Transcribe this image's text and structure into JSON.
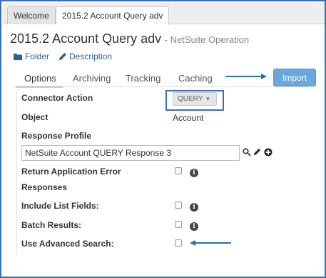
{
  "tabs": [
    {
      "label": "Welcome",
      "active": false
    },
    {
      "label": "2015.2 Account Query adv",
      "active": true
    }
  ],
  "page": {
    "title": "2015.2 Account Query adv",
    "subtitle": "- NetSuite Operation"
  },
  "links": {
    "folder": "Folder",
    "description": "Description"
  },
  "subtabs": [
    {
      "label": "Options",
      "active": true
    },
    {
      "label": "Archiving",
      "active": false
    },
    {
      "label": "Tracking",
      "active": false
    },
    {
      "label": "Caching",
      "active": false
    }
  ],
  "import_button": "Import",
  "form": {
    "connector_action": {
      "label": "Connector Action",
      "value": "QUERY"
    },
    "object": {
      "label": "Object",
      "value": "Account"
    },
    "response_profile": {
      "label": "Response Profile",
      "value": "NetSuite Account QUERY Response 3"
    },
    "return_app_error": {
      "label_line1": "Return Application Error",
      "label_line2": "Responses",
      "checked": false
    },
    "include_list_fields": {
      "label": "Include List Fields:",
      "checked": false
    },
    "batch_results": {
      "label": "Batch Results:",
      "checked": false
    },
    "use_advanced_search": {
      "label": "Use Advanced Search:",
      "checked": false
    }
  },
  "icons": {
    "info": "i",
    "folder": "folder-icon",
    "description": "pencil-icon",
    "search": "search-icon",
    "edit": "pencil-icon",
    "add": "plus-circle-icon"
  },
  "colors": {
    "accent": "#3b6fb6",
    "import_button": "#6aa7dd",
    "link": "#2a6496"
  }
}
